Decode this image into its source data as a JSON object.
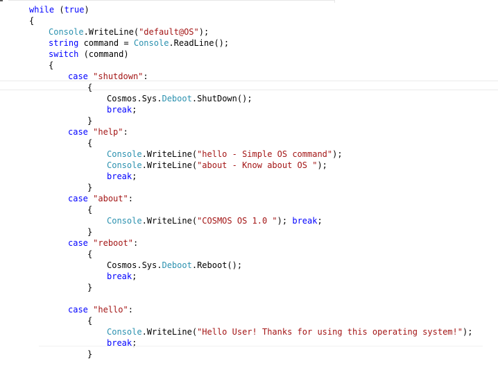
{
  "editor": {
    "lines": [
      {
        "tokens": [
          {
            "text": "while",
            "kind": "kw"
          },
          {
            "text": " (",
            "kind": "plain"
          },
          {
            "text": "true",
            "kind": "kw"
          },
          {
            "text": ")",
            "kind": "plain"
          }
        ]
      },
      {
        "tokens": [
          {
            "text": "{",
            "kind": "plain"
          }
        ]
      },
      {
        "tokens": [
          {
            "text": "Console",
            "kind": "type"
          },
          {
            "text": ".WriteLine(",
            "kind": "plain"
          },
          {
            "text": "\"default@OS\"",
            "kind": "str"
          },
          {
            "text": ");",
            "kind": "plain"
          }
        ]
      },
      {
        "tokens": [
          {
            "text": "string",
            "kind": "kw"
          },
          {
            "text": " command = ",
            "kind": "plain"
          },
          {
            "text": "Console",
            "kind": "type"
          },
          {
            "text": ".ReadLine();",
            "kind": "plain"
          }
        ]
      },
      {
        "tokens": [
          {
            "text": "switch",
            "kind": "kw"
          },
          {
            "text": " (command)",
            "kind": "plain"
          }
        ]
      },
      {
        "tokens": [
          {
            "text": "{",
            "kind": "plain"
          }
        ]
      },
      {
        "tokens": [
          {
            "text": "case",
            "kind": "kw"
          },
          {
            "text": " ",
            "kind": "plain"
          },
          {
            "text": "\"shutdown\"",
            "kind": "str"
          },
          {
            "text": ":",
            "kind": "plain"
          }
        ]
      },
      {
        "tokens": [
          {
            "text": "{",
            "kind": "plain"
          }
        ]
      },
      {
        "tokens": [
          {
            "text": "Cosmos.Sys.",
            "kind": "plain"
          },
          {
            "text": "Deboot",
            "kind": "type"
          },
          {
            "text": ".ShutDown();",
            "kind": "plain"
          }
        ]
      },
      {
        "tokens": [
          {
            "text": "break",
            "kind": "kw"
          },
          {
            "text": ";",
            "kind": "plain"
          }
        ]
      },
      {
        "tokens": [
          {
            "text": "}",
            "kind": "plain"
          }
        ]
      },
      {
        "tokens": [
          {
            "text": "case",
            "kind": "kw"
          },
          {
            "text": " ",
            "kind": "plain"
          },
          {
            "text": "\"help\"",
            "kind": "str"
          },
          {
            "text": ":",
            "kind": "plain"
          }
        ]
      },
      {
        "tokens": [
          {
            "text": "{",
            "kind": "plain"
          }
        ]
      },
      {
        "tokens": [
          {
            "text": "Console",
            "kind": "type"
          },
          {
            "text": ".WriteLine(",
            "kind": "plain"
          },
          {
            "text": "\"hello - Simple OS command\"",
            "kind": "str"
          },
          {
            "text": ");",
            "kind": "plain"
          }
        ]
      },
      {
        "tokens": [
          {
            "text": "Console",
            "kind": "type"
          },
          {
            "text": ".WriteLine(",
            "kind": "plain"
          },
          {
            "text": "\"about - Know about OS \"",
            "kind": "str"
          },
          {
            "text": ");",
            "kind": "plain"
          }
        ]
      },
      {
        "tokens": [
          {
            "text": "break",
            "kind": "kw"
          },
          {
            "text": ";",
            "kind": "plain"
          }
        ]
      },
      {
        "tokens": [
          {
            "text": "}",
            "kind": "plain"
          }
        ]
      },
      {
        "tokens": [
          {
            "text": "case",
            "kind": "kw"
          },
          {
            "text": " ",
            "kind": "plain"
          },
          {
            "text": "\"about\"",
            "kind": "str"
          },
          {
            "text": ":",
            "kind": "plain"
          }
        ]
      },
      {
        "tokens": [
          {
            "text": "{",
            "kind": "plain"
          }
        ]
      },
      {
        "tokens": [
          {
            "text": "Console",
            "kind": "type"
          },
          {
            "text": ".WriteLine(",
            "kind": "plain"
          },
          {
            "text": "\"COSMOS OS 1.0 \"",
            "kind": "str"
          },
          {
            "text": "); ",
            "kind": "plain"
          },
          {
            "text": "break",
            "kind": "kw"
          },
          {
            "text": ";",
            "kind": "plain"
          }
        ]
      },
      {
        "tokens": [
          {
            "text": "}",
            "kind": "plain"
          }
        ]
      },
      {
        "tokens": [
          {
            "text": "case",
            "kind": "kw"
          },
          {
            "text": " ",
            "kind": "plain"
          },
          {
            "text": "\"reboot\"",
            "kind": "str"
          },
          {
            "text": ":",
            "kind": "plain"
          }
        ]
      },
      {
        "tokens": [
          {
            "text": "{",
            "kind": "plain"
          }
        ]
      },
      {
        "tokens": [
          {
            "text": "Cosmos.Sys.",
            "kind": "plain"
          },
          {
            "text": "Deboot",
            "kind": "type"
          },
          {
            "text": ".Reboot();",
            "kind": "plain"
          }
        ]
      },
      {
        "tokens": [
          {
            "text": "break",
            "kind": "kw"
          },
          {
            "text": ";",
            "kind": "plain"
          }
        ]
      },
      {
        "tokens": [
          {
            "text": "}",
            "kind": "plain"
          }
        ]
      },
      {
        "tokens": [
          {
            "text": "case",
            "kind": "kw"
          },
          {
            "text": " ",
            "kind": "plain"
          },
          {
            "text": "\"hello\"",
            "kind": "str"
          },
          {
            "text": ":",
            "kind": "plain"
          }
        ]
      },
      {
        "tokens": [
          {
            "text": "{",
            "kind": "plain"
          }
        ]
      },
      {
        "tokens": [
          {
            "text": "Console",
            "kind": "type"
          },
          {
            "text": ".WriteLine(",
            "kind": "plain"
          },
          {
            "text": "\"Hello User! Thanks for using this operating system!\"",
            "kind": "str"
          },
          {
            "text": ");",
            "kind": "plain"
          }
        ]
      },
      {
        "tokens": [
          {
            "text": "break",
            "kind": "kw"
          },
          {
            "text": ";",
            "kind": "plain"
          }
        ]
      },
      {
        "tokens": [
          {
            "text": "}",
            "kind": "plain"
          }
        ]
      }
    ]
  },
  "colors": {
    "keyword": "#0000ff",
    "type": "#2b91af",
    "string": "#a31515",
    "plain": "#000000",
    "background": "#ffffff"
  }
}
